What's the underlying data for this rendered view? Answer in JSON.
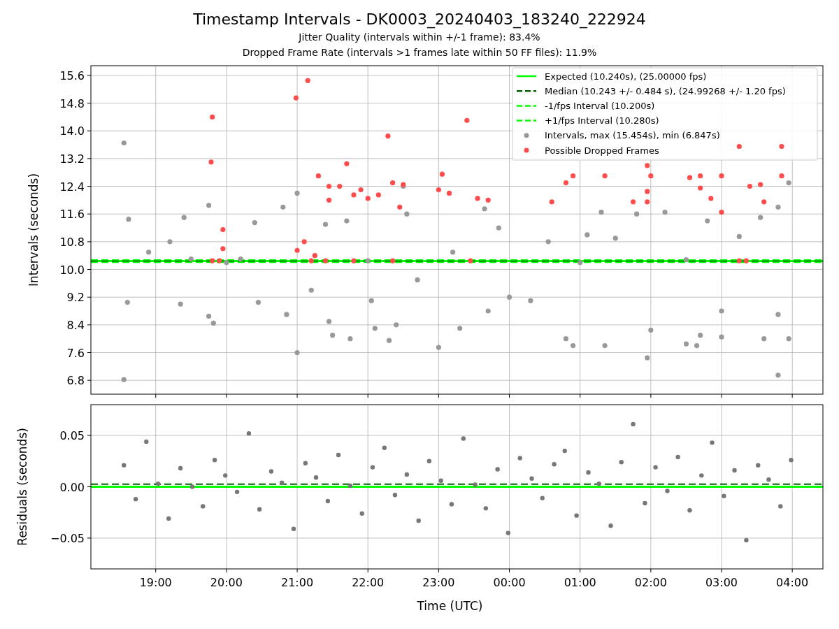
{
  "figure": {
    "title": "Timestamp Intervals - DK0003_20240403_183240_222924",
    "subtitles": [
      "Jitter Quality (intervals within +/-1 frame): 83.4%",
      "Dropped Frame Rate (intervals >1 frames late within 50 FF files): 11.9%"
    ]
  },
  "intervals_panel": {
    "chart_data": {
      "type": "scatter",
      "grid": true,
      "legend": "upper right",
      "ylabel": "Intervals (seconds)",
      "xlim": [
        "2024-04-03T18:05",
        "2024-04-04T04:26"
      ],
      "ylim": [
        6.4,
        15.88
      ],
      "yticks": [
        {
          "value": 6.8,
          "label": "6.8"
        },
        {
          "value": 7.6,
          "label": "7.6"
        },
        {
          "value": 8.4,
          "label": "8.4"
        },
        {
          "value": 9.2,
          "label": "9.2"
        },
        {
          "value": 10,
          "label": "10.0"
        },
        {
          "value": 10.8,
          "label": "10.8"
        },
        {
          "value": 11.6,
          "label": "11.6"
        },
        {
          "value": 12.4,
          "label": "12.4"
        },
        {
          "value": 13.2,
          "label": "13.2"
        },
        {
          "value": 14,
          "label": "14.0"
        },
        {
          "value": 14.8,
          "label": "14.8"
        },
        {
          "value": 15.6,
          "label": "15.6"
        }
      ],
      "ref_lines": [
        {
          "axis": "y",
          "label": "Expected (10.240s), (25.00000 fps)",
          "color": "#00ff00",
          "value": 10.24
        },
        {
          "axis": "y",
          "label": "Median (10.243 +/- 0.484 s), (24.99268 +/- 1.20 fps)",
          "color": "#006400",
          "value": 10.243
        },
        {
          "axis": "y",
          "label": "-1/fps Interval (10.200s)",
          "color": "#00ff00",
          "value": 10.2
        },
        {
          "axis": "y",
          "label": "+1/fps Interval (10.280s)",
          "color": "#00ff00",
          "value": 10.28
        }
      ],
      "series": [
        {
          "name": "Intervals, max (15.454s), min (6.847s)",
          "color": "#999999",
          "x": [
            "2024-04-03T18:33",
            "2024-04-03T18:33",
            "2024-04-03T18:36",
            "2024-04-03T18:37",
            "2024-04-03T18:54",
            "2024-04-03T19:12",
            "2024-04-03T19:24",
            "2024-04-03T19:21",
            "2024-04-03T19:45",
            "2024-04-03T19:45",
            "2024-04-03T19:49",
            "2024-04-03T20:12",
            "2024-04-03T20:24",
            "2024-04-03T20:27",
            "2024-04-03T20:48",
            "2024-04-03T20:51",
            "2024-04-03T21:00",
            "2024-04-03T21:00",
            "2024-04-03T21:12",
            "2024-04-03T21:24",
            "2024-04-03T21:27",
            "2024-04-03T21:30",
            "2024-04-03T21:42",
            "2024-04-03T21:45",
            "2024-04-03T22:03",
            "2024-04-03T22:06",
            "2024-04-03T22:18",
            "2024-04-03T22:24",
            "2024-04-03T22:30",
            "2024-04-03T22:33",
            "2024-04-03T22:42",
            "2024-04-03T23:00",
            "2024-04-03T23:12",
            "2024-04-03T23:18",
            "2024-04-03T23:39",
            "2024-04-03T23:42",
            "2024-04-03T23:51",
            "2024-04-04T00:00",
            "2024-04-04T00:18",
            "2024-04-04T00:33",
            "2024-04-04T00:48",
            "2024-04-04T00:54",
            "2024-04-04T01:06",
            "2024-04-04T01:18",
            "2024-04-04T01:21",
            "2024-04-04T01:30",
            "2024-04-04T01:48",
            "2024-04-04T01:57",
            "2024-04-04T02:00",
            "2024-04-04T02:12",
            "2024-04-04T02:30",
            "2024-04-04T02:39",
            "2024-04-04T02:48",
            "2024-04-04T03:00",
            "2024-04-04T03:00",
            "2024-04-04T03:15",
            "2024-04-04T03:33",
            "2024-04-04T03:36",
            "2024-04-04T03:48",
            "2024-04-04T03:48",
            "2024-04-04T03:48",
            "2024-04-04T03:57",
            "2024-04-04T03:57",
            "2024-04-04T02:42",
            "2024-04-03T19:30",
            "2024-04-03T20:00",
            "2024-04-03T22:00",
            "2024-04-04T01:00",
            "2024-04-04T02:30"
          ],
          "values": [
            13.65,
            6.82,
            9.05,
            11.45,
            10.5,
            10.8,
            11.5,
            9.0,
            11.85,
            8.65,
            8.45,
            10.3,
            11.35,
            9.05,
            11.8,
            8.7,
            7.6,
            12.2,
            9.4,
            11.3,
            8.5,
            8.1,
            11.4,
            8.0,
            9.1,
            8.3,
            7.95,
            8.4,
            12.4,
            11.6,
            9.7,
            7.75,
            10.5,
            8.3,
            11.75,
            8.8,
            11.2,
            9.2,
            9.1,
            10.8,
            8.0,
            7.8,
            11.0,
            11.65,
            7.8,
            10.9,
            11.6,
            7.45,
            8.25,
            11.65,
            7.85,
            7.8,
            11.4,
            8.8,
            8.05,
            10.95,
            11.5,
            8.0,
            11.8,
            6.95,
            8.7,
            12.5,
            8.0,
            8.1,
            10.3,
            10.2,
            10.25,
            10.2,
            10.28
          ]
        },
        {
          "name": "Possible Dropped Frames",
          "color": "#ff4d4d",
          "x": [
            "2024-04-03T19:48",
            "2024-04-03T19:47",
            "2024-04-03T19:57",
            "2024-04-03T19:57",
            "2024-04-03T19:48",
            "2024-04-03T19:54",
            "2024-04-03T20:59",
            "2024-04-03T21:09",
            "2024-04-03T21:00",
            "2024-04-03T21:06",
            "2024-04-03T21:15",
            "2024-04-03T21:18",
            "2024-04-03T21:27",
            "2024-04-03T21:27",
            "2024-04-03T21:36",
            "2024-04-03T21:42",
            "2024-04-03T21:48",
            "2024-04-03T21:54",
            "2024-04-03T22:00",
            "2024-04-03T22:09",
            "2024-04-03T22:17",
            "2024-04-03T22:21",
            "2024-04-03T22:27",
            "2024-04-03T22:30",
            "2024-04-03T23:00",
            "2024-04-03T23:03",
            "2024-04-03T23:09",
            "2024-04-03T23:24",
            "2024-04-03T23:33",
            "2024-04-03T23:42",
            "2024-04-04T00:36",
            "2024-04-04T00:48",
            "2024-04-04T00:54",
            "2024-04-04T01:21",
            "2024-04-04T01:45",
            "2024-04-04T01:57",
            "2024-04-04T01:57",
            "2024-04-04T01:57",
            "2024-04-04T02:00",
            "2024-04-04T02:33",
            "2024-04-04T02:42",
            "2024-04-04T02:42",
            "2024-04-04T02:51",
            "2024-04-04T03:00",
            "2024-04-04T03:00",
            "2024-04-04T03:15",
            "2024-04-04T03:24",
            "2024-04-04T03:33",
            "2024-04-04T03:36",
            "2024-04-04T03:51",
            "2024-04-04T03:51",
            "2024-04-03T21:12",
            "2024-04-03T21:24",
            "2024-04-03T21:48",
            "2024-04-03T22:21",
            "2024-04-03T23:27",
            "2024-04-04T03:15",
            "2024-04-04T03:21"
          ],
          "values": [
            14.4,
            13.1,
            11.15,
            10.6,
            10.25,
            10.25,
            14.95,
            15.45,
            10.55,
            10.8,
            10.4,
            12.7,
            12.4,
            12.0,
            12.4,
            13.05,
            12.15,
            12.3,
            12.05,
            12.15,
            13.85,
            12.5,
            11.8,
            12.45,
            12.3,
            12.75,
            12.2,
            14.3,
            12.05,
            12.0,
            11.95,
            12.5,
            12.7,
            12.7,
            11.95,
            12.25,
            11.95,
            13.0,
            12.7,
            12.65,
            12.7,
            12.35,
            12.05,
            12.7,
            11.65,
            13.55,
            12.4,
            12.45,
            11.95,
            12.7,
            13.55,
            10.25,
            10.25,
            10.25,
            10.25,
            10.25,
            10.25,
            10.25
          ]
        }
      ]
    }
  },
  "residuals_panel": {
    "chart_data": {
      "type": "scatter",
      "grid": true,
      "xlabel": "Time (UTC)",
      "ylabel": "Residuals (seconds)",
      "xlim": [
        "2024-04-03T18:05",
        "2024-04-04T04:26"
      ],
      "ylim": [
        -0.08,
        0.08
      ],
      "xticks": [
        {
          "value": "2024-04-03T19:00",
          "label": "19:00"
        },
        {
          "value": "2024-04-03T20:00",
          "label": "20:00"
        },
        {
          "value": "2024-04-03T21:00",
          "label": "21:00"
        },
        {
          "value": "2024-04-03T22:00",
          "label": "22:00"
        },
        {
          "value": "2024-04-03T23:00",
          "label": "23:00"
        },
        {
          "value": "2024-04-04T00:00",
          "label": "00:00"
        },
        {
          "value": "2024-04-04T01:00",
          "label": "01:00"
        },
        {
          "value": "2024-04-04T02:00",
          "label": "02:00"
        },
        {
          "value": "2024-04-04T03:00",
          "label": "03:00"
        },
        {
          "value": "2024-04-04T04:00",
          "label": "04:00"
        }
      ],
      "yticks": [
        {
          "value": -0.05,
          "label": "−0.05"
        },
        {
          "value": 0,
          "label": "0.00"
        },
        {
          "value": 0.05,
          "label": "0.05"
        }
      ],
      "ref_lines": [
        {
          "axis": "y",
          "color": "#00ff00",
          "value": 0
        },
        {
          "axis": "y",
          "color": "#006400",
          "value": 0.0025
        }
      ],
      "series": [
        {
          "color": "#777777",
          "x": [
            "2024-04-03T18:33",
            "2024-04-03T18:43",
            "2024-04-03T18:52",
            "2024-04-03T19:02",
            "2024-04-03T19:11",
            "2024-04-03T19:21",
            "2024-04-03T19:31",
            "2024-04-03T19:40",
            "2024-04-03T19:50",
            "2024-04-03T19:59",
            "2024-04-03T20:09",
            "2024-04-03T20:19",
            "2024-04-03T20:28",
            "2024-04-03T20:38",
            "2024-04-03T20:47",
            "2024-04-03T20:57",
            "2024-04-03T21:07",
            "2024-04-03T21:16",
            "2024-04-03T21:26",
            "2024-04-03T21:35",
            "2024-04-03T21:45",
            "2024-04-03T21:55",
            "2024-04-03T22:04",
            "2024-04-03T22:14",
            "2024-04-03T22:23",
            "2024-04-03T22:33",
            "2024-04-03T22:43",
            "2024-04-03T22:52",
            "2024-04-03T23:02",
            "2024-04-03T23:11",
            "2024-04-03T23:21",
            "2024-04-03T23:31",
            "2024-04-03T23:40",
            "2024-04-03T23:50",
            "2024-04-03T23:59",
            "2024-04-04T00:09",
            "2024-04-04T00:19",
            "2024-04-04T00:28",
            "2024-04-04T00:38",
            "2024-04-04T00:47",
            "2024-04-04T00:57",
            "2024-04-04T01:07",
            "2024-04-04T01:16",
            "2024-04-04T01:26",
            "2024-04-04T01:35",
            "2024-04-04T01:45",
            "2024-04-04T01:55",
            "2024-04-04T02:04",
            "2024-04-04T02:14",
            "2024-04-04T02:23",
            "2024-04-04T02:33",
            "2024-04-04T02:43",
            "2024-04-04T02:52",
            "2024-04-04T03:02",
            "2024-04-04T03:11",
            "2024-04-04T03:21",
            "2024-04-04T03:31",
            "2024-04-04T03:40",
            "2024-04-04T03:50",
            "2024-04-04T03:59"
          ],
          "values": [
            0.021,
            -0.012,
            0.044,
            0.003,
            -0.031,
            0.018,
            0.0,
            -0.019,
            0.026,
            0.011,
            -0.005,
            0.052,
            -0.022,
            0.015,
            0.004,
            -0.041,
            0.023,
            0.009,
            -0.014,
            0.031,
            0.001,
            -0.026,
            0.019,
            0.038,
            -0.008,
            0.012,
            -0.033,
            0.025,
            0.006,
            -0.017,
            0.047,
            0.002,
            -0.021,
            0.017,
            -0.045,
            0.028,
            0.008,
            -0.011,
            0.022,
            0.035,
            -0.028,
            0.014,
            0.003,
            -0.038,
            0.024,
            0.061,
            -0.016,
            0.019,
            -0.004,
            0.029,
            -0.023,
            0.011,
            0.043,
            -0.009,
            0.016,
            -0.052,
            0.021,
            0.007,
            -0.019,
            0.026
          ]
        }
      ]
    }
  }
}
